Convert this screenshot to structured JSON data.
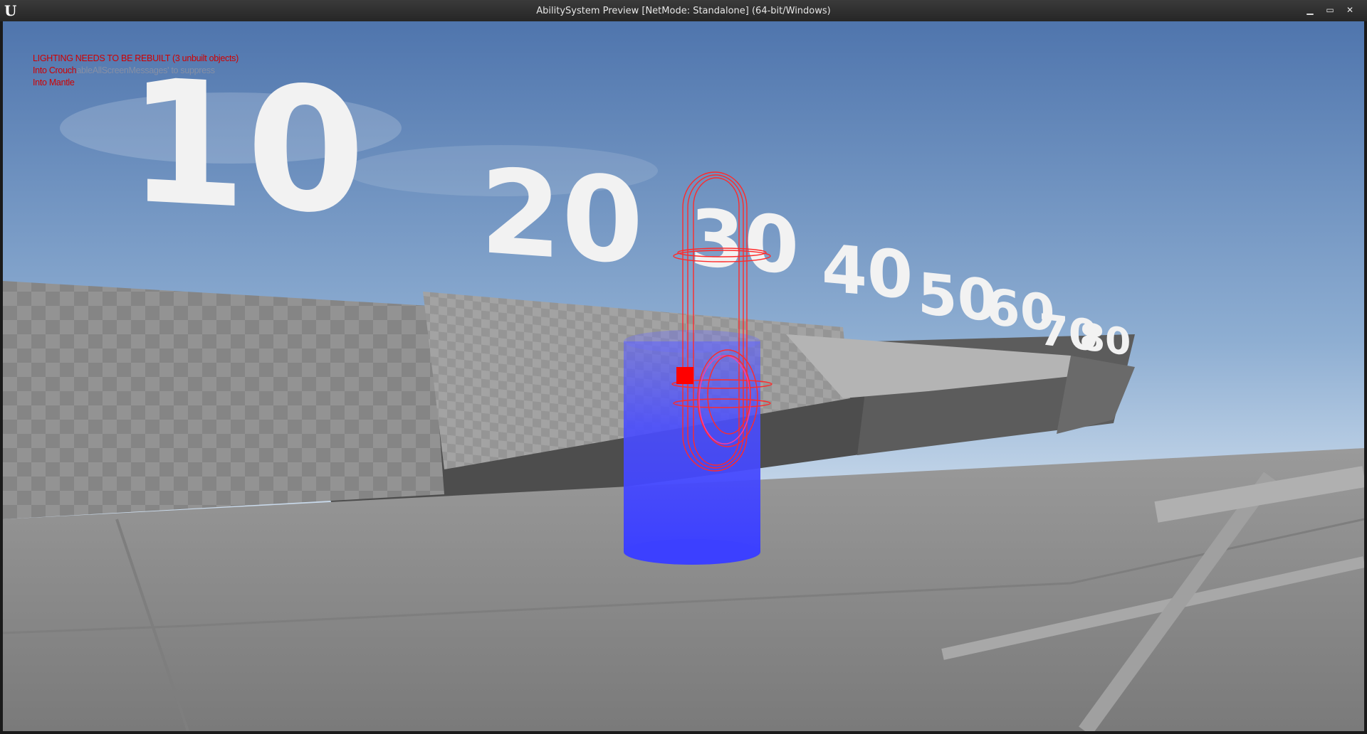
{
  "window": {
    "title": "AbilitySystem Preview [NetMode: Standalone]  (64-bit/Windows)",
    "logo": "U",
    "minimize_icon": "minimize-icon",
    "maximize_icon": "maximize-icon",
    "close_icon": "close-icon",
    "minimize_glyph": "▁",
    "maximize_glyph": "▭",
    "close_glyph": "✕"
  },
  "debug_messages": {
    "lighting": "LIGHTING NEEDS TO BE REBUILT (3 unbuilt objects)",
    "line2_red": "Into Crouch",
    "line2_ghost": "ableAllScreenMessages' to suppress",
    "line3": "Into Mantle"
  },
  "distance_markers": [
    "10",
    "20",
    "30",
    "40",
    "50",
    "60",
    "70",
    "80"
  ],
  "colors": {
    "debug_text": "#d00000",
    "capsule_wire": "#ff2a2a",
    "cylinder": "#4a4dff",
    "sky_top": "#5a7fb5",
    "sky_horizon": "#dce8f5",
    "floor": "#8c8c8c"
  }
}
